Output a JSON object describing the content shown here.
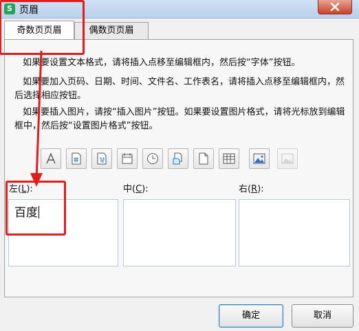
{
  "window": {
    "title": "页眉",
    "app_icon_letter": "S"
  },
  "tabs": [
    {
      "label": "奇数页页眉",
      "active": true
    },
    {
      "label": "偶数页页眉",
      "active": false
    }
  ],
  "instructions": [
    "如果要设置文本格式，请将插入点移至编辑框内，然后按“字体”按钮。",
    "如果要加入页码、日期、时间、文件名、工作表名，请将插入点移至编辑框内，然后选择相应按钮。",
    "如果要插入图片，请按“插入图片”按钮。如果要设置图片格式，请将光标放到编辑框中，然后按“设置图片格式”按钮。"
  ],
  "toolbar": [
    {
      "icon": "font-icon",
      "label": "A",
      "enabled": true
    },
    {
      "icon": "page-number-icon",
      "label": "#",
      "enabled": true
    },
    {
      "icon": "total-pages-icon",
      "enabled": true
    },
    {
      "icon": "date-icon",
      "enabled": true
    },
    {
      "icon": "time-icon",
      "enabled": true
    },
    {
      "icon": "file-path-icon",
      "enabled": true
    },
    {
      "icon": "file-name-icon",
      "enabled": true
    },
    {
      "icon": "sheet-name-icon",
      "enabled": true
    },
    {
      "icon": "insert-picture-icon",
      "enabled": true
    },
    {
      "icon": "format-picture-icon",
      "enabled": false
    }
  ],
  "sections": {
    "left": {
      "label": "左(",
      "key": "L",
      "suffix": "):",
      "value": "百度"
    },
    "center": {
      "label": "中(",
      "key": "C",
      "suffix": "):",
      "value": ""
    },
    "right": {
      "label": "右(",
      "key": "R",
      "suffix": "):",
      "value": ""
    }
  },
  "buttons": {
    "ok": "确定",
    "cancel": "取消"
  },
  "colors": {
    "annotation": "#e21b1b",
    "titlebar": "#c4d8ef",
    "close": "#c7432a",
    "app_icon": "#27a35a"
  }
}
